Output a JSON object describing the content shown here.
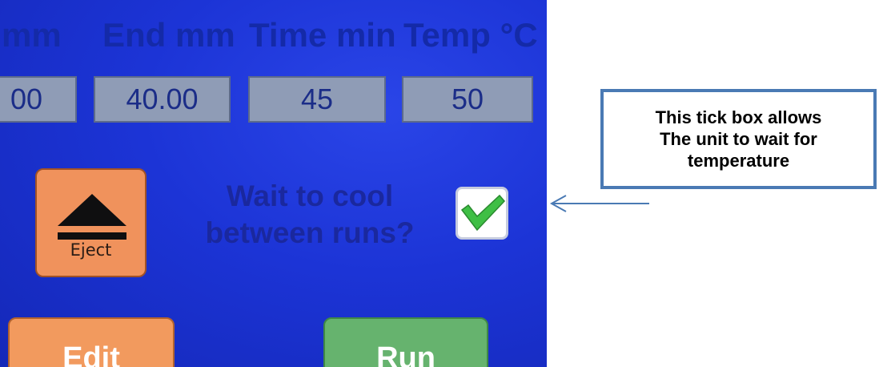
{
  "screen": {
    "headers": [
      "mm",
      "End mm",
      "Time min",
      "Temp °C"
    ],
    "fields": [
      "00",
      "40.00",
      "45",
      "50"
    ],
    "eject_label": "Eject",
    "wait_line1": "Wait to cool",
    "wait_line2": "between runs?",
    "checkbox_checked": true,
    "edit_label": "Edit",
    "run_label": "Run"
  },
  "callout": {
    "text": "This tick box allows\nThe unit to wait  for\ntemperature"
  },
  "colors": {
    "screen_bg": "#1c34d6",
    "field_bg": "#8f9cb6",
    "eject_orange": "#f0925c",
    "run_green": "#66b36e",
    "check_green": "#3fbf45",
    "callout_border": "#4a7ab4"
  },
  "icons": {
    "eject": "eject-icon",
    "check": "checkmark-icon",
    "arrow": "left-arrow-icon"
  }
}
